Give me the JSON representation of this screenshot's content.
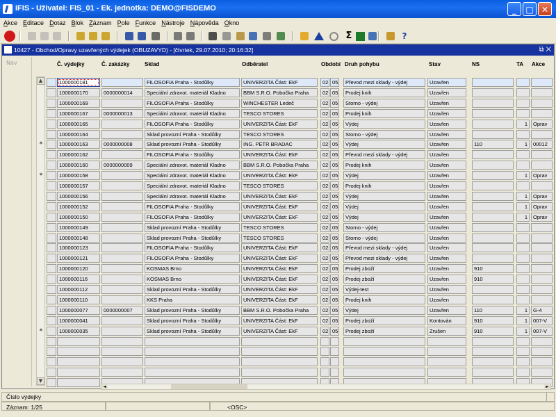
{
  "window": {
    "title": "iFIS - Uživatel: FIS_01 - Ek. jednotka: DEMO@FISDEMO"
  },
  "menu": [
    "Akce",
    "Editace",
    "Dotaz",
    "Blok",
    "Záznam",
    "Pole",
    "Funkce",
    "Nástroje",
    "Nápověda",
    "Okno"
  ],
  "toolbar_icons": [
    "exit-icon",
    "arrow-icon",
    "arrow-icon",
    "arrow-icon",
    "key-icon",
    "key-icon",
    "key-icon",
    "sort-asc-icon",
    "sort-desc-icon",
    "filter-icon",
    "print-icon",
    "print-preview-icon",
    "cut-icon",
    "copy-icon",
    "paste-icon",
    "find-icon",
    "list-icon",
    "tree-icon",
    "star-icon",
    "triangle-icon",
    "clock-icon",
    "sigma-icon",
    "excel-icon",
    "export-icon",
    "help-icon",
    "question-icon"
  ],
  "inner": {
    "title": "10427 - Obchod/Opravy uzavřených výdejek (OBUZAVYD) - [čtvrtek, 29.07.2010; 20:16:32]",
    "nav_label": "Nav"
  },
  "columns": [
    "Č. výdejky",
    "Č. zakázky",
    "Sklad",
    "Odběratel",
    "Období",
    "Druh pohybu",
    "Stav",
    "NS",
    "TA",
    "Akce"
  ],
  "rows": [
    {
      "m": "",
      "vyd": "1000000181",
      "zak": "",
      "sklad": "FILOSOFIA Praha - Stodůlky",
      "odb": "UNIVERZITA Část: EkF",
      "o1": "02",
      "o2": "05",
      "druh": "Převod mezi sklady - výdej",
      "stav": "Uzavřen",
      "ns": "",
      "ta": "",
      "akce": ""
    },
    {
      "m": "",
      "vyd": "1000000170",
      "zak": "0000000014",
      "sklad": "Speciální zdravot. materiál Kladno",
      "odb": "BBM S.R.O. Pobočka Praha",
      "o1": "02",
      "o2": "05",
      "druh": "Prodej knih",
      "stav": "Uzavřen",
      "ns": "",
      "ta": "",
      "akce": ""
    },
    {
      "m": "",
      "vyd": "1000000169",
      "zak": "",
      "sklad": "FILOSOFIA Praha - Stodůlky",
      "odb": "WINCHESTER Ledeč",
      "o1": "02",
      "o2": "05",
      "druh": "Storno - výdej",
      "stav": "Uzavřen",
      "ns": "",
      "ta": "",
      "akce": ""
    },
    {
      "m": "",
      "vyd": "1000000167",
      "zak": "0000000013",
      "sklad": "Speciální zdravot. materiál Kladno",
      "odb": "TESCO STORES",
      "o1": "02",
      "o2": "05",
      "druh": "Prodej knih",
      "stav": "Uzavřen",
      "ns": "",
      "ta": "",
      "akce": ""
    },
    {
      "m": "",
      "vyd": "1000000165",
      "zak": "",
      "sklad": "FILOSOFIA Praha - Stodůlky",
      "odb": "UNIVERZITA Část: EkF",
      "o1": "02",
      "o2": "05",
      "druh": "Výdej",
      "stav": "Uzavřen",
      "ns": "",
      "ta": "1",
      "akce": "Oprav"
    },
    {
      "m": "",
      "vyd": "1000000164",
      "zak": "",
      "sklad": "Sklad provozní Praha - Stodůlky",
      "odb": "TESCO STORES",
      "o1": "02",
      "o2": "05",
      "druh": "Storno - výdej",
      "stav": "Uzavřen",
      "ns": "",
      "ta": "",
      "akce": ""
    },
    {
      "m": "*",
      "vyd": "1000000163",
      "zak": "0000000008",
      "sklad": "Sklad provozní Praha - Stodůlky",
      "odb": "ING. PETR BRADAC",
      "o1": "02",
      "o2": "05",
      "druh": "Výdej",
      "stav": "Uzavřen",
      "ns": "110",
      "ta": "1",
      "akce": "00012"
    },
    {
      "m": "",
      "vyd": "1000000162",
      "zak": "",
      "sklad": "FILOSOFIA Praha - Stodůlky",
      "odb": "UNIVERZITA Část: EkF",
      "o1": "02",
      "o2": "05",
      "druh": "Převod mezi sklady - výdej",
      "stav": "Uzavřen",
      "ns": "",
      "ta": "",
      "akce": ""
    },
    {
      "m": "",
      "vyd": "1000000160",
      "zak": "0000000009",
      "sklad": "Speciální zdravot. materiál Kladno",
      "odb": "BBM S.R.O. Pobočka Praha",
      "o1": "02",
      "o2": "05",
      "druh": "Prodej knih",
      "stav": "Uzavřen",
      "ns": "",
      "ta": "",
      "akce": ""
    },
    {
      "m": "*",
      "vyd": "1000000158",
      "zak": "",
      "sklad": "Speciální zdravot. materiál Kladno",
      "odb": "UNIVERZITA Část: EkF",
      "o1": "02",
      "o2": "05",
      "druh": "Výdej",
      "stav": "Uzavřen",
      "ns": "",
      "ta": "1",
      "akce": "Oprav"
    },
    {
      "m": "",
      "vyd": "1000000157",
      "zak": "",
      "sklad": "Speciální zdravot. materiál Kladno",
      "odb": "TESCO STORES",
      "o1": "02",
      "o2": "05",
      "druh": "Prodej knih",
      "stav": "Uzavřen",
      "ns": "",
      "ta": "",
      "akce": ""
    },
    {
      "m": "",
      "vyd": "1000000156",
      "zak": "",
      "sklad": "Speciální zdravot. materiál Kladno",
      "odb": "UNIVERZITA Část: EkF",
      "o1": "02",
      "o2": "05",
      "druh": "Výdej",
      "stav": "Uzavřen",
      "ns": "",
      "ta": "1",
      "akce": "Oprav"
    },
    {
      "m": "",
      "vyd": "1000000152",
      "zak": "",
      "sklad": "FILOSOFIA Praha - Stodůlky",
      "odb": "UNIVERZITA Část: EkF",
      "o1": "02",
      "o2": "05",
      "druh": "Výdej",
      "stav": "Uzavřen",
      "ns": "",
      "ta": "1",
      "akce": "Oprav"
    },
    {
      "m": "",
      "vyd": "1000000150",
      "zak": "",
      "sklad": "FILOSOFIA Praha - Stodůlky",
      "odb": "UNIVERZITA Část: EkF",
      "o1": "02",
      "o2": "05",
      "druh": "Výdej",
      "stav": "Uzavřen",
      "ns": "",
      "ta": "1",
      "akce": "Oprav"
    },
    {
      "m": "",
      "vyd": "1000000149",
      "zak": "",
      "sklad": "Sklad provozní Praha - Stodůlky",
      "odb": "TESCO STORES",
      "o1": "02",
      "o2": "05",
      "druh": "Storno - výdej",
      "stav": "Uzavřen",
      "ns": "",
      "ta": "",
      "akce": ""
    },
    {
      "m": "",
      "vyd": "1000000148",
      "zak": "",
      "sklad": "Sklad provozní Praha - Stodůlky",
      "odb": "TESCO STORES",
      "o1": "02",
      "o2": "05",
      "druh": "Storno - výdej",
      "stav": "Uzavřen",
      "ns": "",
      "ta": "",
      "akce": ""
    },
    {
      "m": "",
      "vyd": "1000000123",
      "zak": "",
      "sklad": "FILOSOFIA Praha - Stodůlky",
      "odb": "UNIVERZITA Část: EkF",
      "o1": "02",
      "o2": "05",
      "druh": "Převod mezi sklady - výdej",
      "stav": "Uzavřen",
      "ns": "",
      "ta": "",
      "akce": ""
    },
    {
      "m": "",
      "vyd": "1000000121",
      "zak": "",
      "sklad": "FILOSOFIA Praha - Stodůlky",
      "odb": "UNIVERZITA Část: EkF",
      "o1": "02",
      "o2": "05",
      "druh": "Převod mezi sklady - výdej",
      "stav": "Uzavřen",
      "ns": "",
      "ta": "",
      "akce": ""
    },
    {
      "m": "",
      "vyd": "1000000120",
      "zak": "",
      "sklad": "KOSMAS Brno",
      "odb": "UNIVERZITA Část: EkF",
      "o1": "02",
      "o2": "05",
      "druh": "Prodej zboží",
      "stav": "Uzavřen",
      "ns": "910",
      "ta": "",
      "akce": ""
    },
    {
      "m": "",
      "vyd": "1000000116",
      "zak": "",
      "sklad": "KOSMAS Brno",
      "odb": "UNIVERZITA Část: EkF",
      "o1": "02",
      "o2": "05",
      "druh": "Prodej zboží",
      "stav": "Uzavřen",
      "ns": "910",
      "ta": "",
      "akce": ""
    },
    {
      "m": "",
      "vyd": "1000000112",
      "zak": "",
      "sklad": "Sklad provozní Praha - Stodůlky",
      "odb": "UNIVERZITA Část: EkF",
      "o1": "02",
      "o2": "05",
      "druh": "Výdej-test",
      "stav": "Uzavřen",
      "ns": "",
      "ta": "",
      "akce": ""
    },
    {
      "m": "",
      "vyd": "1000000110",
      "zak": "",
      "sklad": "KKS Praha",
      "odb": "UNIVERZITA Část: EkF",
      "o1": "02",
      "o2": "05",
      "druh": "Prodej knih",
      "stav": "Uzavřen",
      "ns": "",
      "ta": "",
      "akce": ""
    },
    {
      "m": "",
      "vyd": "1000000077",
      "zak": "0000000007",
      "sklad": "Sklad provozní Praha - Stodůlky",
      "odb": "BBM S.R.O. Pobočka Praha",
      "o1": "02",
      "o2": "05",
      "druh": "Výdej",
      "stav": "Uzavřen",
      "ns": "110",
      "ta": "1",
      "akce": "G-4"
    },
    {
      "m": "",
      "vyd": "1000000041",
      "zak": "",
      "sklad": "Sklad provozní Praha - Stodůlky",
      "odb": "UNIVERZITA Část: EkF",
      "o1": "02",
      "o2": "05",
      "druh": "Prodej zboží",
      "stav": "Kontován",
      "ns": "910",
      "ta": "1",
      "akce": "007-V"
    },
    {
      "m": "*",
      "vyd": "1000000035",
      "zak": "",
      "sklad": "Sklad provozní Praha - Stodůlky",
      "odb": "UNIVERZITA Část: EkF",
      "o1": "02",
      "o2": "05",
      "druh": "Prodej zboží",
      "stav": "Zrušen",
      "ns": "910",
      "ta": "1",
      "akce": "007-V"
    }
  ],
  "empty_rows": 5,
  "status": {
    "hint": "Číslo výdejky",
    "record": "Záznam: 1/25",
    "mode": "<OSC>"
  }
}
